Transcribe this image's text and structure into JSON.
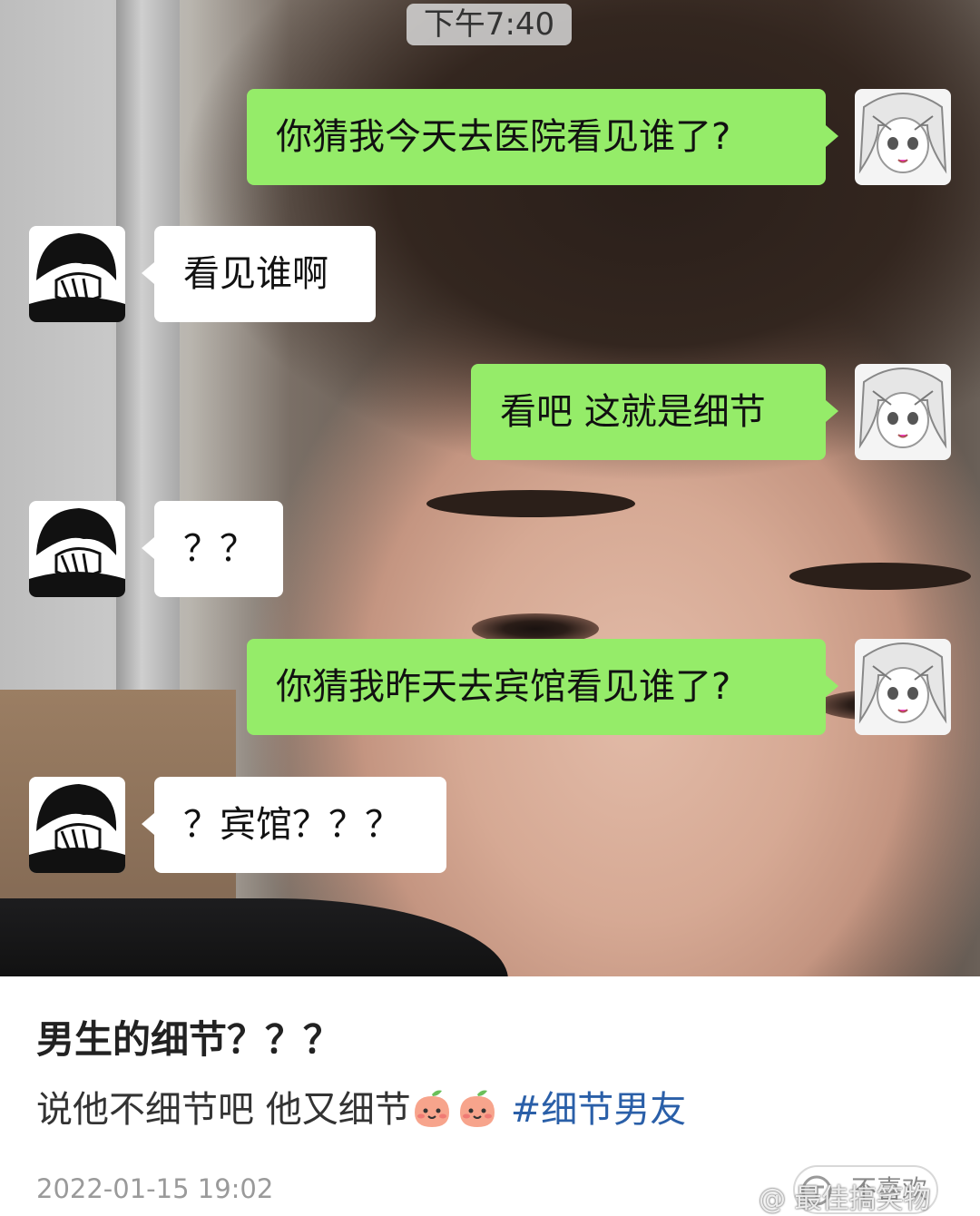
{
  "status": {
    "time": "下午7:40"
  },
  "messages": [
    {
      "side": "me",
      "text": "你猜我今天去医院看见谁了?"
    },
    {
      "side": "other",
      "text": "看见谁啊"
    },
    {
      "side": "me",
      "text": "看吧 这就是细节"
    },
    {
      "side": "other",
      "text": "？？"
    },
    {
      "side": "me",
      "text": "你猜我昨天去宾馆看见谁了?"
    },
    {
      "side": "other",
      "text": "？宾馆？？？"
    }
  ],
  "post": {
    "title": "男生的细节？？？",
    "body": "说他不细节吧 他又细节",
    "hashtag": "#细节男友",
    "date": "2022-01-15 19:02",
    "like_label": "不喜欢",
    "watermark": "@ 最佳搞笑物"
  },
  "colors": {
    "my_bubble": "#95ec69",
    "other_bubble": "#ffffff",
    "hashtag": "#2a5fa8"
  }
}
